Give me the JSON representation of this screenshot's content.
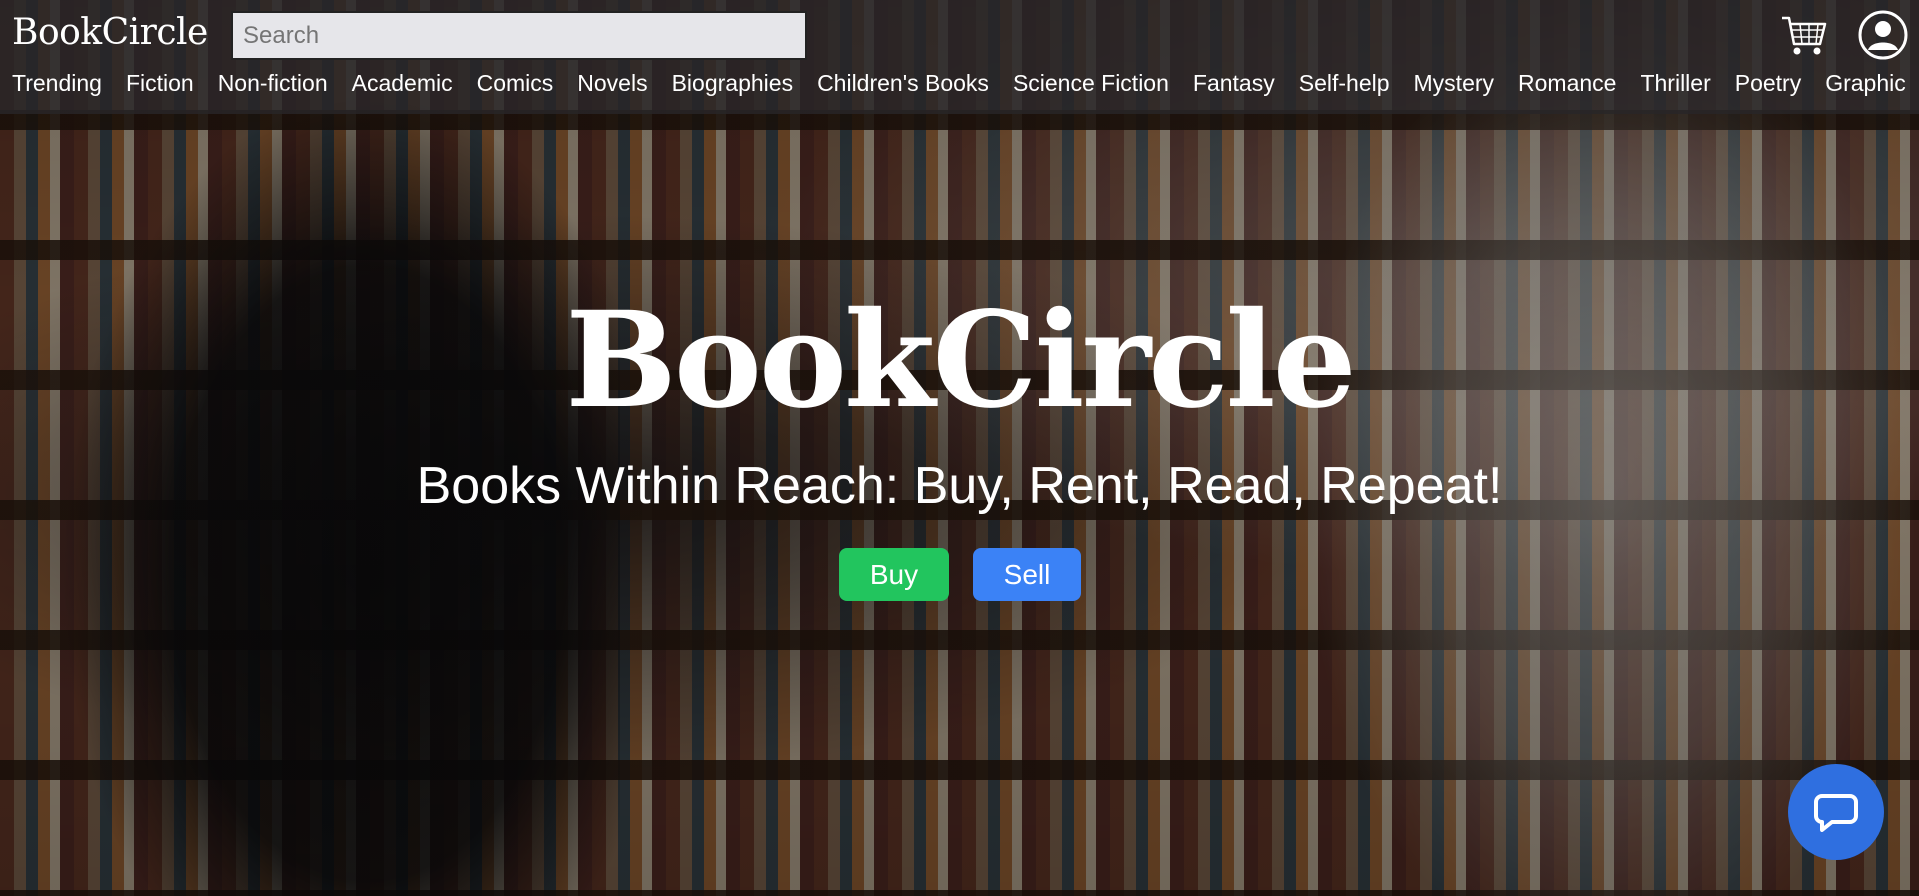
{
  "header": {
    "logo": "BookCircle",
    "search_placeholder": "Search",
    "cart_icon": "cart-icon",
    "user_icon": "user-icon"
  },
  "nav": {
    "items": [
      "Trending",
      "Fiction",
      "Non-fiction",
      "Academic",
      "Comics",
      "Novels",
      "Biographies",
      "Children's Books",
      "Science Fiction",
      "Fantasy",
      "Self-help",
      "Mystery",
      "Romance",
      "Thriller",
      "Poetry",
      "Graphic Novels"
    ]
  },
  "hero": {
    "title": "BookCircle",
    "subtitle": "Books Within Reach: Buy, Rent, Read, Repeat!",
    "buy_label": "Buy",
    "sell_label": "Sell"
  },
  "colors": {
    "buy_button": "#22c55e",
    "sell_button": "#3b82f6",
    "chat_button": "#2f6fe0",
    "header_bg": "rgba(40,38,40,0.82)"
  },
  "chat": {
    "icon": "chat-bubble-icon"
  }
}
